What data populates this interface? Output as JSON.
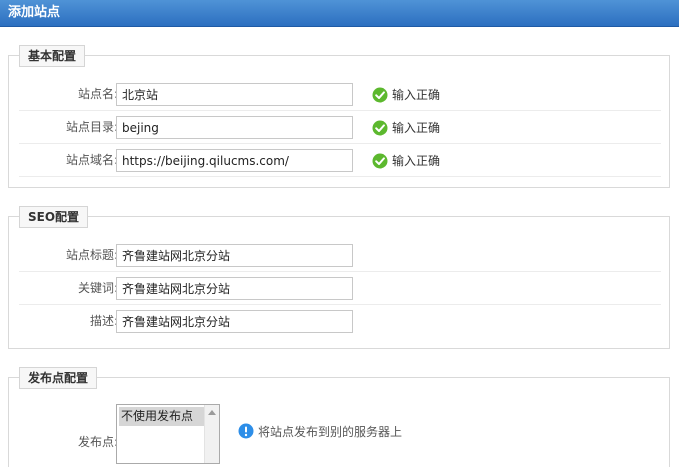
{
  "header": {
    "title": "添加站点"
  },
  "sections": {
    "basic": {
      "legend": "基本配置",
      "rows": [
        {
          "label": "站点名:",
          "value": "北京站",
          "status": "输入正确"
        },
        {
          "label": "站点目录:",
          "value": "bejing",
          "status": "输入正确"
        },
        {
          "label": "站点域名:",
          "value": "https://beijing.qilucms.com/",
          "status": "输入正确"
        }
      ]
    },
    "seo": {
      "legend": "SEO配置",
      "rows": [
        {
          "label": "站点标题:",
          "value": "齐鲁建站网北京分站"
        },
        {
          "label": "关键词:",
          "value": "齐鲁建站网北京分站"
        },
        {
          "label": "描述:",
          "value": "齐鲁建站网北京分站"
        }
      ]
    },
    "publish": {
      "legend": "发布点配置",
      "label": "发布点:",
      "options": [
        "不使用发布点"
      ],
      "hint": "将站点发布到别的服务器上"
    }
  },
  "colors": {
    "title_bar": "#2c6fc0",
    "success": "#5cb82e",
    "info": "#2d8ee8"
  },
  "icons": {
    "status": "check-circle-icon",
    "hint": "info-circle-icon"
  }
}
